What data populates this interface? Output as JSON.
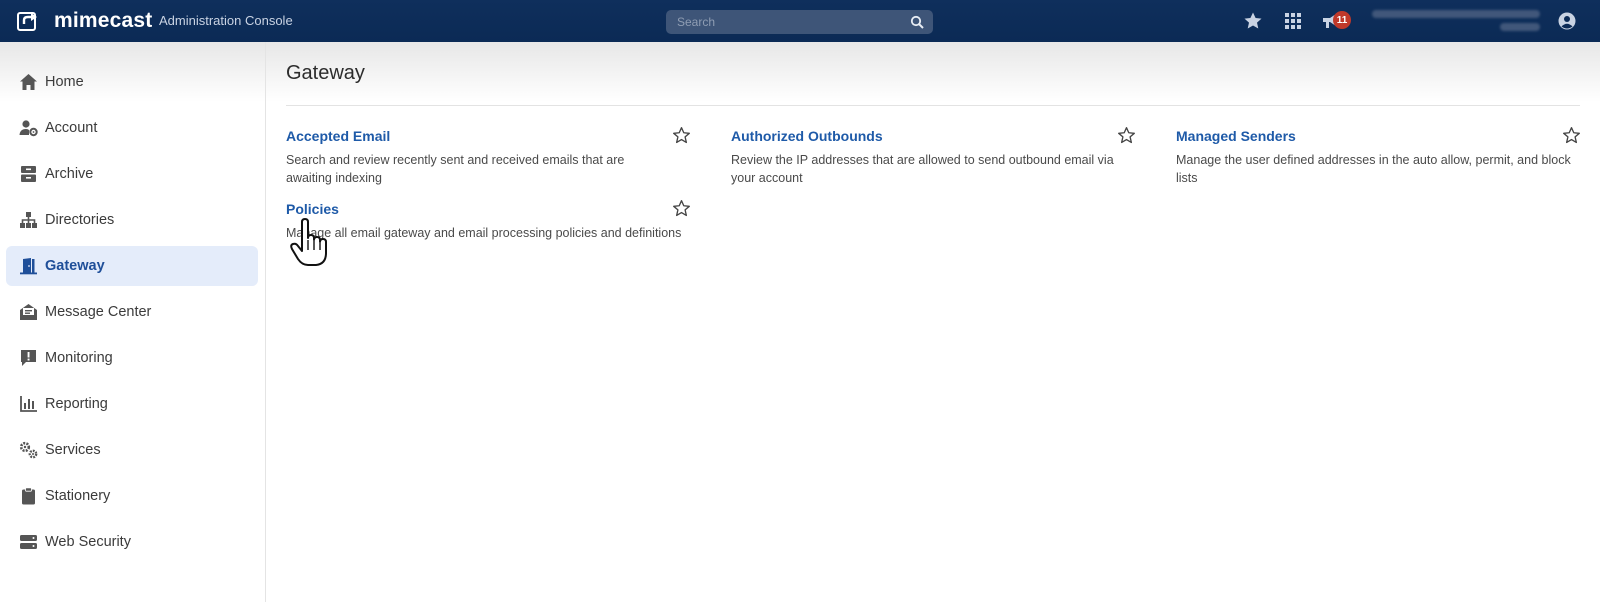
{
  "header": {
    "brand": "mimecast",
    "console_title": "Administration Console",
    "search_placeholder": "Search",
    "notification_count": "11",
    "colors": {
      "bar": "#0b2a55",
      "accent": "#1e5aa8",
      "badge": "#c0392b"
    }
  },
  "sidebar": {
    "items": [
      {
        "label": "Home",
        "icon": "home-icon"
      },
      {
        "label": "Account",
        "icon": "account-gear-icon"
      },
      {
        "label": "Archive",
        "icon": "archive-icon"
      },
      {
        "label": "Directories",
        "icon": "directories-icon"
      },
      {
        "label": "Gateway",
        "icon": "gateway-door-icon",
        "active": true
      },
      {
        "label": "Message Center",
        "icon": "message-center-icon"
      },
      {
        "label": "Monitoring",
        "icon": "monitoring-alert-icon"
      },
      {
        "label": "Reporting",
        "icon": "reporting-chart-icon"
      },
      {
        "label": "Services",
        "icon": "services-gears-icon"
      },
      {
        "label": "Stationery",
        "icon": "stationery-clipboard-icon"
      },
      {
        "label": "Web Security",
        "icon": "web-security-server-icon"
      }
    ]
  },
  "main": {
    "title": "Gateway",
    "cards": [
      {
        "title": "Accepted Email",
        "description": "Search and review recently sent and received emails that are awaiting indexing"
      },
      {
        "title": "Authorized Outbounds",
        "description": "Review the IP addresses that are allowed to send outbound email via your account"
      },
      {
        "title": "Managed Senders",
        "description": "Manage the user defined addresses in the auto allow, permit, and block lists"
      },
      {
        "title": "Policies",
        "description": "Manage all email gateway and email processing policies and definitions"
      }
    ]
  }
}
